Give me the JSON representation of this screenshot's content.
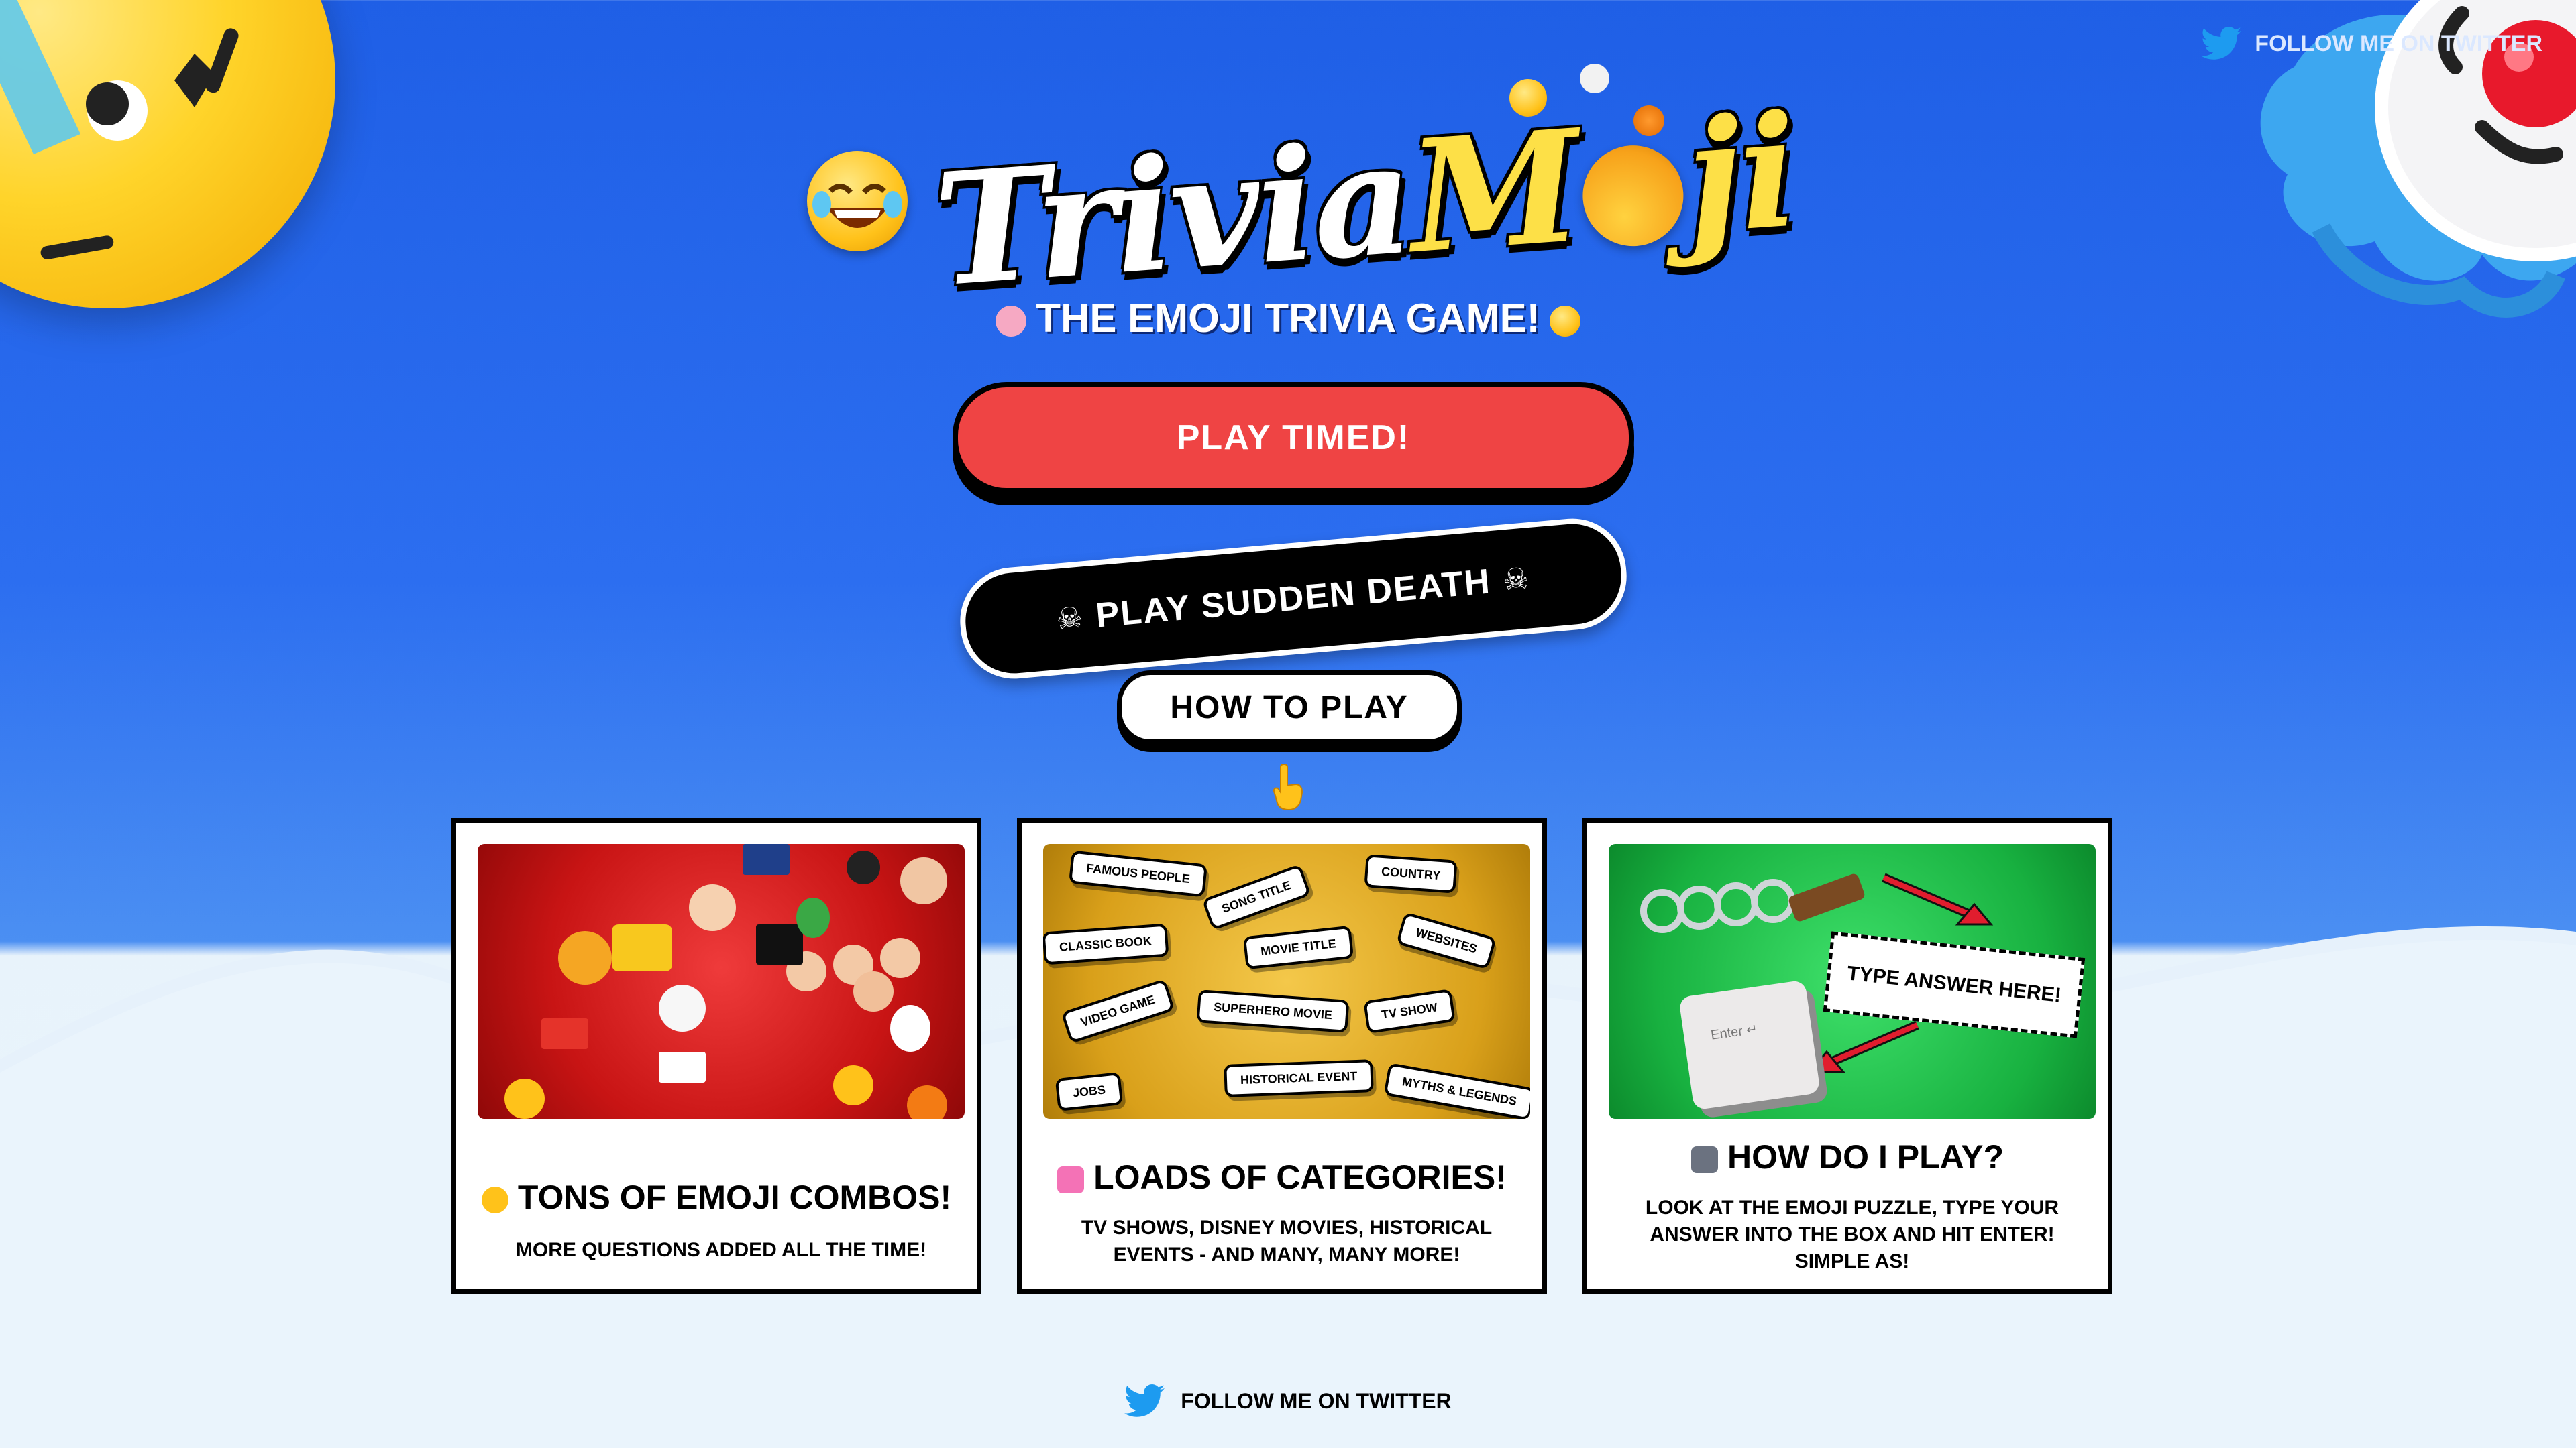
{
  "header": {
    "twitter_label": "FOLLOW ME ON TWITTER"
  },
  "logo": {
    "text_white": "Trivia",
    "text_yellow_1": "M",
    "text_yellow_2": "ji"
  },
  "subtitle": "THE EMOJI TRIVIA GAME!",
  "buttons": {
    "timed": "PLAY TIMED!",
    "sudden_death": "PLAY SUDDEN DEATH",
    "how_to": "HOW TO PLAY"
  },
  "cards": [
    {
      "title": "TONS OF EMOJI COMBOS!",
      "desc": "MORE QUESTIONS ADDED ALL THE TIME!"
    },
    {
      "title": "LOADS OF CATEGORIES!",
      "desc": "TV SHOWS, DISNEY MOVIES, HISTORICAL EVENTS - AND MANY, MANY MORE!",
      "tags": [
        "FAMOUS PEOPLE",
        "SONG TITLE",
        "COUNTRY",
        "CLASSIC BOOK",
        "MOVIE TITLE",
        "WEBSITES",
        "VIDEO GAME",
        "SUPERHERO MOVIE",
        "TV SHOW",
        "JOBS",
        "HISTORICAL EVENT",
        "MYTHS & LEGENDS"
      ]
    },
    {
      "title": "HOW DO I PLAY?",
      "desc": "LOOK AT THE EMOJI PUZZLE, TYPE YOUR ANSWER INTO THE BOX AND HIT ENTER! SIMPLE AS!",
      "type_box": "TYPE ANSWER HERE!",
      "enter_key": "Enter ↵"
    }
  ],
  "footer": {
    "twitter_label": "FOLLOW ME ON TWITTER"
  },
  "colors": {
    "primary_blue": "#1f5fe6",
    "timed_red": "#ef4444",
    "logo_yellow": "#fde047",
    "twitter_blue": "#1d9bf0"
  }
}
